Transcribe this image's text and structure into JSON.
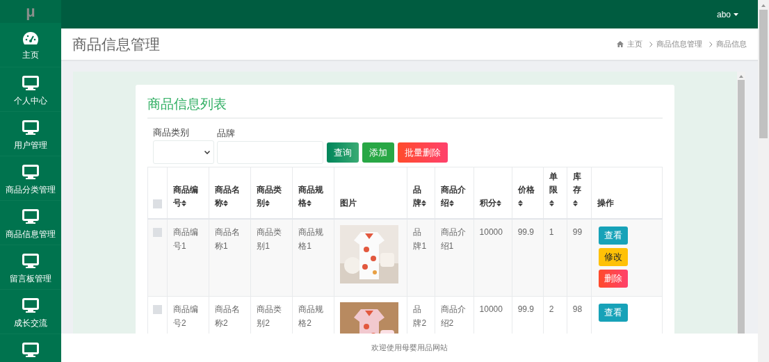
{
  "logo": "μ",
  "user_menu": {
    "label": "abo"
  },
  "sidebar": {
    "items": [
      {
        "kind": "gauge",
        "label": "主页"
      },
      {
        "kind": "monitor",
        "label": "个人中心"
      },
      {
        "kind": "monitor",
        "label": "用户管理"
      },
      {
        "kind": "monitor",
        "label": "商品分类管理"
      },
      {
        "kind": "monitor",
        "label": "商品信息管理"
      },
      {
        "kind": "monitor",
        "label": "留言板管理"
      },
      {
        "kind": "monitor",
        "label": "成长交流"
      },
      {
        "kind": "monitor"
      }
    ]
  },
  "page_title": "商品信息管理",
  "breadcrumb": [
    "主页",
    "商品信息管理",
    "商品信息"
  ],
  "card": {
    "title": "商品信息列表",
    "filters": [
      {
        "kind": "select",
        "label": "商品类别"
      },
      {
        "kind": "text",
        "label": "品牌"
      }
    ],
    "buttons": [
      {
        "kind": "search",
        "label": "查询"
      },
      {
        "kind": "add",
        "label": "添加"
      },
      {
        "kind": "delete",
        "label": "批量删除"
      }
    ],
    "table": {
      "select_all": {
        "checked": false
      },
      "columns": [
        {
          "label": "商品编号",
          "sortable": true
        },
        {
          "label": "商品名称",
          "sortable": true
        },
        {
          "label": "商品类别",
          "sortable": true
        },
        {
          "label": "商品规格",
          "sortable": true
        },
        {
          "label": "图片",
          "sortable": false
        },
        {
          "label": "品牌",
          "sortable": true
        },
        {
          "label": "商品介绍",
          "sortable": true
        },
        {
          "label": "积分",
          "sortable": true
        },
        {
          "label": "价格",
          "sortable": true
        },
        {
          "label": "单限",
          "sortable": true
        },
        {
          "label": "库存",
          "sortable": true
        },
        {
          "label": "操作",
          "sortable": false
        }
      ],
      "rows": [
        {
          "checked": false,
          "cells": [
            "商品编号1",
            "商品名称1",
            "商品类别1",
            "商品规格1",
            {
              "kind": "picture"
            },
            "品牌1",
            "商品介绍1",
            "10000",
            "99.9",
            "1",
            "99"
          ],
          "actions": [
            {
              "kind": "view",
              "label": "查看"
            },
            {
              "kind": "edit",
              "label": "修改"
            },
            {
              "kind": "delete",
              "label": "删除"
            }
          ]
        },
        {
          "checked": false,
          "cells": [
            "商品编号2",
            "商品名称2",
            "商品类别2",
            "商品规格2",
            {
              "kind": "picture"
            },
            "品牌2",
            "商品介绍2",
            "10000",
            "99.9",
            "2",
            "98"
          ],
          "actions": [
            {
              "kind": "view",
              "label": "查看"
            }
          ]
        }
      ]
    }
  },
  "footer": "欢迎使用母婴用品网站"
}
